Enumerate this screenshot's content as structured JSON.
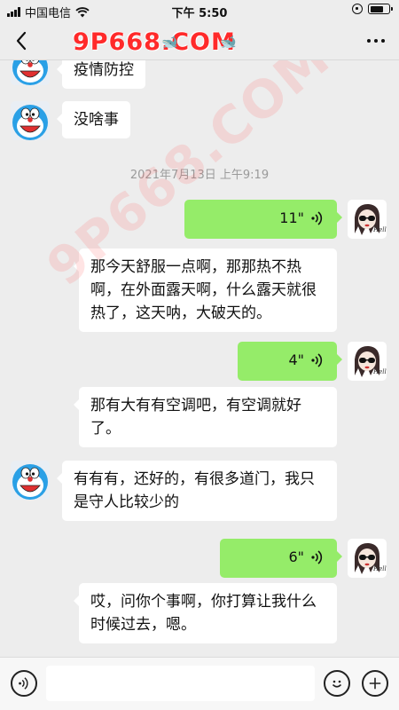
{
  "status_bar": {
    "carrier": "中国电信",
    "time": "下午 5:50"
  },
  "nav": {
    "title": "9P668.COM",
    "watermark_small": "9P668.COM",
    "watermark_large": "9P668.COM"
  },
  "chat": {
    "messages": [
      {
        "side": "in",
        "text": "疫情防控"
      },
      {
        "side": "in",
        "text": "没啥事"
      },
      {
        "type": "time",
        "text": "2021年7月13日 上午9:19"
      },
      {
        "side": "out",
        "type": "voice",
        "duration": "11\""
      },
      {
        "side": "in",
        "text": "那今天舒服一点啊，那那热不热啊，在外面露天啊，什么露天就很热了，这天呐，大破天的。"
      },
      {
        "side": "out",
        "type": "voice",
        "duration": "4\""
      },
      {
        "side": "in",
        "text": "那有大有有空调吧，有空调就好了。"
      },
      {
        "side": "in",
        "text": "有有有，还好的，有很多道门，我只是守人比较少的"
      },
      {
        "side": "out",
        "type": "voice",
        "duration": "6\""
      },
      {
        "side": "in",
        "text": "哎，问你个事啊，你打算让我什么时候过去，嗯。"
      }
    ]
  },
  "input": {
    "value": "",
    "placeholder": ""
  },
  "icons": {
    "back": "chevron-left-icon",
    "more": "more-dots-icon",
    "voice_toggle": "voice-input-icon",
    "emoji": "emoji-icon",
    "add": "plus-icon"
  },
  "colors": {
    "background": "#ededed",
    "incoming_bubble": "#ffffff",
    "outgoing_bubble": "#95ec69",
    "timestamp": "#9a9a9a",
    "watermark": "#ff2a2a"
  }
}
